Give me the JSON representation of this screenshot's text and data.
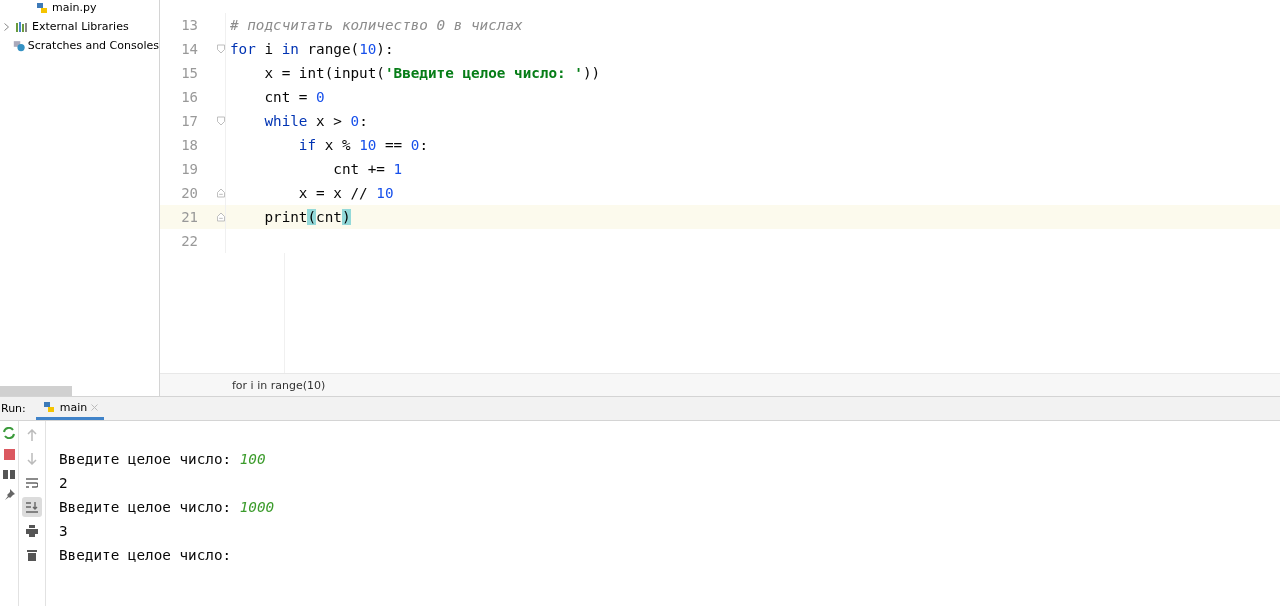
{
  "project_tree": [
    {
      "label": "main.py",
      "expandable": false
    },
    {
      "label": "External Libraries",
      "expandable": true
    },
    {
      "label": "Scratches and Consoles",
      "expandable": false
    }
  ],
  "editor": {
    "lines": [
      {
        "number": "13",
        "current": false,
        "fold_start": false,
        "fold_end": false,
        "tokens": [
          {
            "text": "# подсчитать количество 0 в числах",
            "kind": "comment"
          }
        ]
      },
      {
        "number": "14",
        "current": false,
        "fold_start": true,
        "fold_end": false,
        "tokens": [
          {
            "text": "for",
            "kind": "keyword"
          },
          {
            "text": " i ",
            "kind": "plain"
          },
          {
            "text": "in",
            "kind": "keyword"
          },
          {
            "text": " range(",
            "kind": "plain"
          },
          {
            "text": "10",
            "kind": "number"
          },
          {
            "text": "):",
            "kind": "plain"
          }
        ]
      },
      {
        "number": "15",
        "current": false,
        "fold_start": false,
        "fold_end": false,
        "tokens": [
          {
            "text": "    x = int(input(",
            "kind": "plain"
          },
          {
            "text": "'Введите целое число: '",
            "kind": "string"
          },
          {
            "text": "))",
            "kind": "plain"
          }
        ]
      },
      {
        "number": "16",
        "current": false,
        "fold_start": false,
        "fold_end": false,
        "tokens": [
          {
            "text": "    cnt = ",
            "kind": "plain"
          },
          {
            "text": "0",
            "kind": "number"
          }
        ]
      },
      {
        "number": "17",
        "current": false,
        "fold_start": true,
        "fold_end": false,
        "tokens": [
          {
            "text": "    while",
            "kind": "keyword"
          },
          {
            "text": " x > ",
            "kind": "plain"
          },
          {
            "text": "0",
            "kind": "number"
          },
          {
            "text": ":",
            "kind": "plain"
          }
        ]
      },
      {
        "number": "18",
        "current": false,
        "fold_start": false,
        "fold_end": false,
        "tokens": [
          {
            "text": "        if",
            "kind": "keyword"
          },
          {
            "text": " x % ",
            "kind": "plain"
          },
          {
            "text": "10",
            "kind": "number"
          },
          {
            "text": " == ",
            "kind": "plain"
          },
          {
            "text": "0",
            "kind": "number"
          },
          {
            "text": ":",
            "kind": "plain"
          }
        ]
      },
      {
        "number": "19",
        "current": false,
        "fold_start": false,
        "fold_end": false,
        "tokens": [
          {
            "text": "            cnt += ",
            "kind": "plain"
          },
          {
            "text": "1",
            "kind": "number"
          }
        ]
      },
      {
        "number": "20",
        "current": false,
        "fold_start": false,
        "fold_end": true,
        "tokens": [
          {
            "text": "        x = x // ",
            "kind": "plain"
          },
          {
            "text": "10",
            "kind": "number"
          }
        ]
      },
      {
        "number": "21",
        "current": true,
        "fold_start": false,
        "fold_end": true,
        "tokens": [
          {
            "text": "    print",
            "kind": "plain"
          },
          {
            "text": "(",
            "kind": "brace_match"
          },
          {
            "text": "cnt",
            "kind": "plain"
          },
          {
            "text": ")",
            "kind": "brace_match"
          }
        ]
      },
      {
        "number": "22",
        "current": false,
        "fold_start": false,
        "fold_end": false
      }
    ],
    "breadcrumb": "for i in range(10)"
  },
  "run_panel": {
    "label": "Run:",
    "tab": {
      "label": "main",
      "selected": true
    },
    "console": [
      {
        "segments": [
          {
            "text": "Введите целое число: ",
            "kind": "output"
          },
          {
            "text": "100",
            "kind": "input"
          }
        ]
      },
      {
        "segments": [
          {
            "text": "2",
            "kind": "output"
          }
        ]
      },
      {
        "segments": [
          {
            "text": "Введите целое число: ",
            "kind": "output"
          },
          {
            "text": "1000",
            "kind": "input"
          }
        ]
      },
      {
        "segments": [
          {
            "text": "3",
            "kind": "output"
          }
        ]
      },
      {
        "segments": [
          {
            "text": "Введите целое число:",
            "kind": "output"
          }
        ]
      }
    ],
    "soft_wrap_on": false,
    "scroll_to_end_on": true
  }
}
